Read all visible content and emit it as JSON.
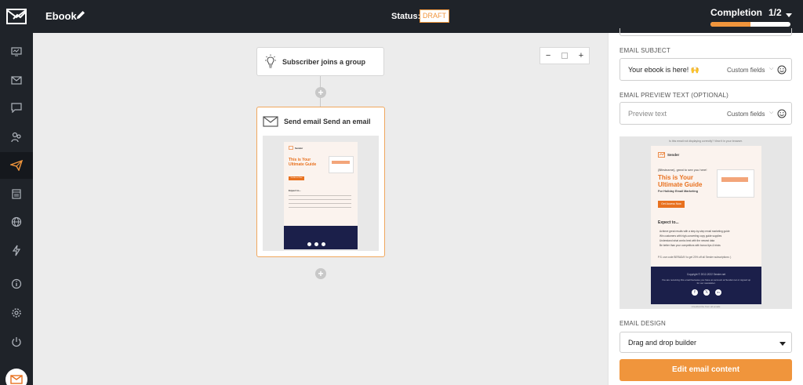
{
  "header": {
    "title": "Ebook",
    "status_label": "Status:",
    "status_value": "DRAFT",
    "completion_label": "Completion",
    "completion_count": "1/2",
    "completion_progress": 0.5
  },
  "sidebar": {
    "items": [
      {
        "icon": "dashboard-icon"
      },
      {
        "icon": "mail-icon"
      },
      {
        "icon": "chat-icon"
      },
      {
        "icon": "subscribers-icon"
      },
      {
        "icon": "campaigns-icon"
      },
      {
        "icon": "calendar-icon"
      },
      {
        "icon": "globe-icon"
      },
      {
        "icon": "automation-icon"
      },
      {
        "icon": "info-icon"
      },
      {
        "icon": "settings-icon"
      },
      {
        "icon": "power-icon"
      }
    ],
    "active_index": 4
  },
  "canvas": {
    "zoom": {
      "minus": "−",
      "plus": "+"
    },
    "trigger_node": {
      "label": "Subscriber joins a group"
    },
    "email_node": {
      "label": "Send email Send an email"
    },
    "add_step": "+"
  },
  "email_preview": {
    "top_note": "Is this email not displaying correctly? View it in your browser.",
    "brand": "Sender",
    "greeting": "{$firstname}, great to see you here!",
    "headline_1": "This is Your",
    "headline_2": "Ultimate Guide",
    "subheadline": "For Holiday Email Marketing",
    "cta": "Get Access Now",
    "expect_title": "Expect to...",
    "bullets": [
      "Achieve great results with a step-by-step email marketing guide",
      "Win customers with high-converting copy guide supplies",
      "Understand what works best with the newest data",
      "Be better than your competitors with bonus tips & tricks"
    ],
    "promo": "P.S. use code BERADAY to get 20% off all Sender subscriptions :)",
    "footer_copyright": "Copyright © 2012-2022 Sender.net",
    "footer_note": "You are receiving this email because you have an account at Sender.net or signed up for our newsletter.",
    "bottom_note": "Unsubscribe from all emails",
    "social": [
      "f",
      "𝕏",
      "in"
    ]
  },
  "panel": {
    "subject_label": "EMAIL SUBJECT",
    "subject_value": "Your ebook is here! 🙌",
    "custom_fields": "Custom fields",
    "preview_label": "EMAIL PREVIEW TEXT (OPTIONAL)",
    "preview_placeholder": "Preview text",
    "design_label": "EMAIL DESIGN",
    "design_value": "Drag and drop builder",
    "edit_button": "Edit email content"
  },
  "colors": {
    "accent": "#f0953c",
    "dark": "#1f2329",
    "brand_orange": "#e8711f",
    "footer_navy": "#1b1f4a"
  }
}
